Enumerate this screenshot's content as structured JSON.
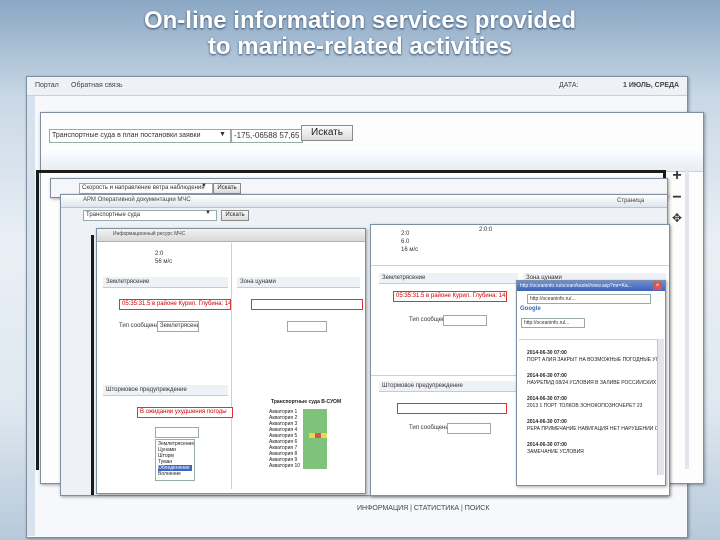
{
  "slide": {
    "title_line1": "On-line information services provided",
    "title_line2": "to marine-related activities"
  },
  "portal": {
    "nav_portal": "Портал",
    "nav_feedback": "Обратная связь",
    "date_label": "ДАТА:",
    "date_value": "1 ИЮЛЬ, СРЕДА",
    "footer_text": "ИНФОРМАЦИЯ | СТАТИСТИКА | ПОИСК"
  },
  "map_search": {
    "select_value": "Транспортные суда в план постановки заявки",
    "coords_value": "-175,-06588 57,65",
    "search_button": "Искать",
    "zoom_in": "+",
    "zoom_out": "−",
    "pan_icon": "move-icon"
  },
  "wind_bar": {
    "select_value": "Скорость и направление ветра наблюдения",
    "search_button": "Искать"
  },
  "arm_window": {
    "title": "АРМ Оперативной документации МЧС",
    "select_value": "Транспортные суда",
    "search_button": "Искать",
    "pages_label": "Страница"
  },
  "left_window": {
    "title": "Информационный ресурс МЧС",
    "earthquake_label": "Землетрясение",
    "earthquake_value": "05:35:31.5 в районе Курил. Глубина: 14,9 км. 2.5",
    "tsunami_label": "Зона цунами",
    "forecast_label": "Штормовое предупреждение",
    "forecast_value": "В ожидании ухудшения погоды",
    "type_label": "Тип сообщения:",
    "type_value": "Землетрясение",
    "small_values": [
      "2:0",
      "56 м/с"
    ],
    "options": [
      "Землетрясение",
      "Цунами",
      "Шторм",
      "Туман",
      "Обледенение",
      "Волнение",
      "Прочее"
    ],
    "grid_title": "Транспортные суда В-СУОМ",
    "grid_rows": [
      "Акватория 1",
      "Акватория 2",
      "Акватория 3",
      "Акватория 4",
      "Акватория 5",
      "Акватория 6",
      "Акватория 7",
      "Акватория 8",
      "Акватория 9",
      "Акватория 10"
    ]
  },
  "right_window": {
    "earthquake_label": "Землетрясение",
    "earthquake_value": "05:35:31.5 в районе Курил. Глубина: 14,9 км. 2.5",
    "tsunami_label": "Зона цунами",
    "storm_label": "Штормовое предупреждение",
    "type_label": "Тип сообщения:",
    "small_values": [
      "2:0",
      "6.0",
      "16 м/с"
    ],
    "scale_value": "2:0:0"
  },
  "browser_window": {
    "title": "http://oceaninfo.ru/ocean/kastel/view.asp?mr=Ka...",
    "address": "http://oceaninfo.ru/...",
    "tab_label": "http://oceaninfo.rul...",
    "google_label": "Google",
    "messages": [
      {
        "date": "2014-06-30 07:00",
        "text": "ПОРТ АЛИЯ ЗАКРЫТ НА ВОЗМОЖНЫЕ ПОГОДНЫЕ УСЛОВИЯ 01 1 ИЮНЯ"
      },
      {
        "date": "2014-06-30 07:00",
        "text": "НАУРЕПИД 08/24 УСЛОВИЯ В ЗАЛИВЕ РОССИЙСКИХ"
      },
      {
        "date": "2014-06-30 07:00",
        "text": "2013 1 ПОРТ ТОЛКОВ ЗОНОКОПОЗНОЧЕРЕТ 23"
      },
      {
        "date": "2014-06-30 07:00",
        "text": "РЕРА ПРИМЕЧАНИЕ НАВИГАЦИЯ НЕТ НАРУШЕНИЙ СЕВЕРНОГО ВОЗДУШ"
      },
      {
        "date": "2014-06-30 07:00",
        "text": "ЗАМЕЧАНИЕ УСЛОВИЯ"
      }
    ]
  }
}
